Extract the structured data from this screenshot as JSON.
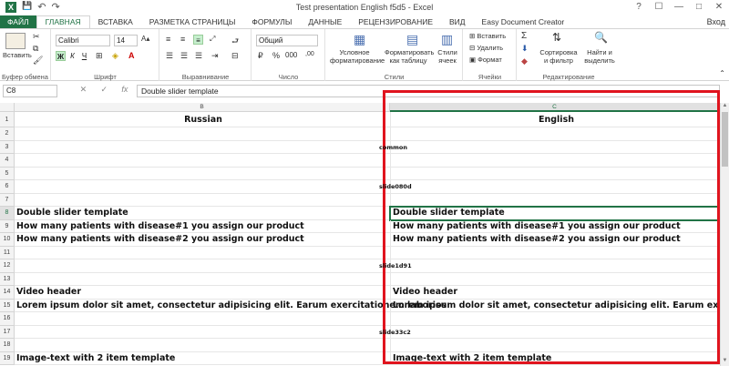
{
  "window": {
    "title": "Test presentation English f5d5 - Excel",
    "app_icon": "X",
    "controls": [
      "?",
      "☐",
      "—",
      "□",
      "✕"
    ]
  },
  "quick_access": {
    "save": "💾",
    "undo": "↶",
    "redo": "↷"
  },
  "tabs": [
    "ФАЙЛ",
    "ГЛАВНАЯ",
    "ВСТАВКА",
    "РАЗМЕТКА СТРАНИЦЫ",
    "ФОРМУЛЫ",
    "ДАННЫЕ",
    "РЕЦЕНЗИРОВАНИЕ",
    "ВИД",
    "Easy Document Creator"
  ],
  "active_tab": 1,
  "signin": "Вход",
  "ribbon": {
    "clipboard": {
      "paste": "Вставить",
      "name": "Буфер обмена"
    },
    "font": {
      "family": "Calibri",
      "size": "14",
      "bold": "Ж",
      "italic": "К",
      "underline": "Ч",
      "name": "Шрифт"
    },
    "alignment": {
      "name": "Выравнивание"
    },
    "number": {
      "format": "Общий",
      "name": "Число"
    },
    "styles": {
      "conditional": [
        "Условное",
        "форматирование"
      ],
      "as_table": [
        "Форматировать",
        "как таблицу"
      ],
      "cell_styles": [
        "Стили",
        "ячеек"
      ],
      "name": "Стили"
    },
    "cells": {
      "insert": "Вставить",
      "delete": "Удалить",
      "format": "Формат",
      "name": "Ячейки"
    },
    "editing": {
      "sort": [
        "Сортировка",
        "и фильтр"
      ],
      "find": [
        "Найти и",
        "выделить"
      ],
      "name": "Редактирование"
    }
  },
  "formula_bar": {
    "name_box": "C8",
    "fx": "fx",
    "cancel": "✕",
    "enter": "✓",
    "content": "Double slider template"
  },
  "columns": [
    "B",
    "C"
  ],
  "rows": [
    {
      "n": "1",
      "b": "Russian",
      "c": "English",
      "type": "header"
    },
    {
      "n": "2",
      "b": "",
      "c": ""
    },
    {
      "n": "3",
      "b": "",
      "c": "",
      "mid": "common"
    },
    {
      "n": "4",
      "b": "",
      "c": ""
    },
    {
      "n": "5",
      "b": "",
      "c": ""
    },
    {
      "n": "6",
      "b": "",
      "c": "",
      "mid": "slide080d"
    },
    {
      "n": "7",
      "b": "",
      "c": ""
    },
    {
      "n": "8",
      "b": "Double slider template",
      "c": "Double slider template"
    },
    {
      "n": "9",
      "b": "How many patients with disease#1 you assign our product",
      "c": "How many patients with disease#1 you assign our product"
    },
    {
      "n": "10",
      "b": "How many patients with disease#2 you assign our product",
      "c": "How many patients with disease#2 you assign our product"
    },
    {
      "n": "11",
      "b": "",
      "c": ""
    },
    {
      "n": "12",
      "b": "",
      "c": "",
      "mid": "slide1d91"
    },
    {
      "n": "13",
      "b": "",
      "c": ""
    },
    {
      "n": "14",
      "b": "Video header",
      "c": "Video header"
    },
    {
      "n": "15",
      "b": "Lorem ipsum dolor sit amet, consectetur adipisicing elit. Earum exercitationem laborios",
      "c": "Lorem ipsum dolor sit amet, consectetur adipisicing elit. Earum exercitationem labor"
    },
    {
      "n": "16",
      "b": "",
      "c": ""
    },
    {
      "n": "17",
      "b": "",
      "c": "",
      "mid": "slide33c2"
    },
    {
      "n": "18",
      "b": "",
      "c": ""
    },
    {
      "n": "19",
      "b": "Image-text with 2 item template",
      "c": "Image-text with 2 item template"
    }
  ],
  "selected_cell": "C8",
  "accent_color": "#217346",
  "highlight_color": "#e0141e"
}
